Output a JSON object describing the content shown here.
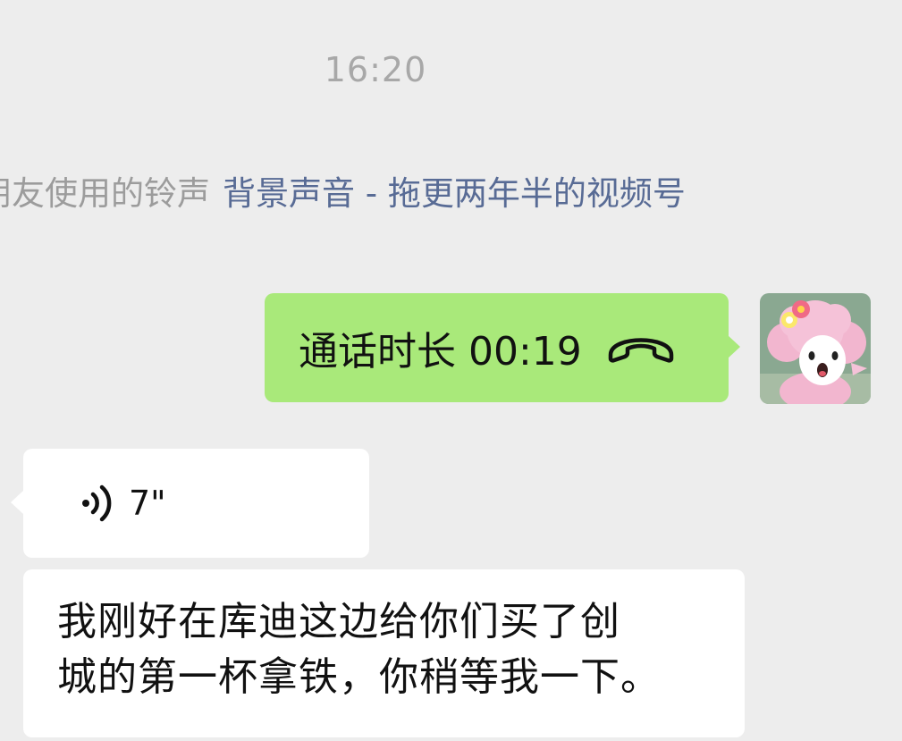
{
  "chat": {
    "timestamp": "16:20",
    "ringtone": {
      "prefix": "朋友使用的铃声",
      "link": "背景声音 - 拖更两年半的视频号"
    },
    "messages": [
      {
        "type": "call",
        "side": "right",
        "text": "通话时长 00:19",
        "icon": "hangup-phone-icon",
        "color": "#a9e97a"
      },
      {
        "type": "voice",
        "side": "left",
        "duration": "7\"",
        "icon": "voice-wave-icon"
      },
      {
        "type": "text",
        "side": "left",
        "lines": [
          "我刚好在库迪这边给你们买了创",
          "城的第一杯拿铁，你稍等我一下。"
        ]
      }
    ]
  }
}
